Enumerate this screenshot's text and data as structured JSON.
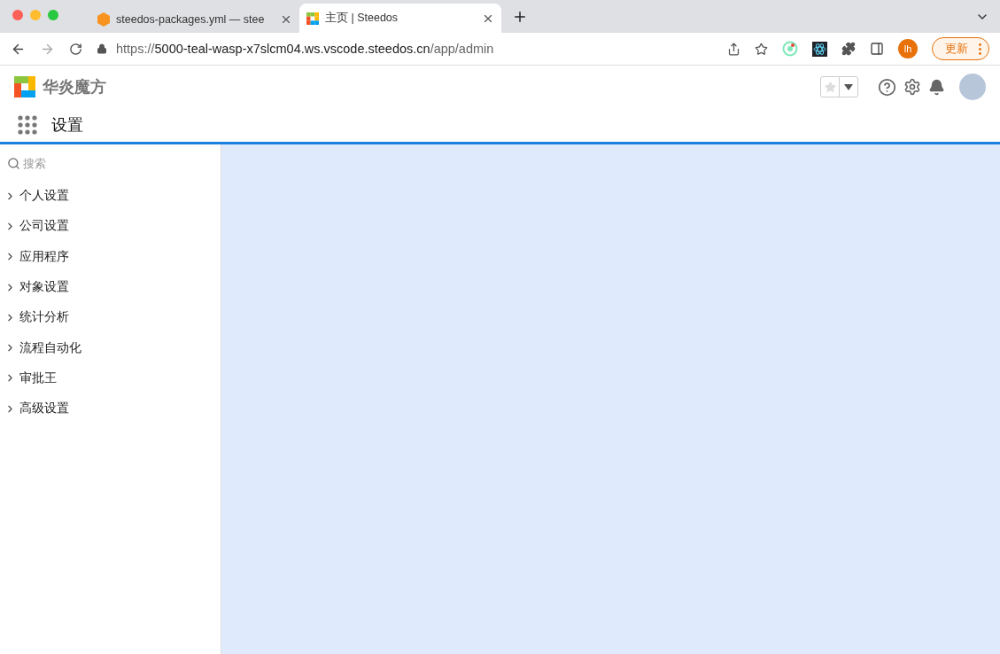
{
  "browser": {
    "tabs": [
      {
        "title": "steedos-packages.yml — stee",
        "selected": false,
        "kind": "editor"
      },
      {
        "title": "主页 | Steedos",
        "selected": true,
        "kind": "app"
      }
    ],
    "url": {
      "scheme": "https://",
      "host": "5000-teal-wasp-x7slcm04.ws.vscode.steedos.cn",
      "path": "/app/admin"
    },
    "profile": "lh",
    "update_button": "更新"
  },
  "app": {
    "logo_text": "华炎魔方",
    "app_name": "设置",
    "favorite": false
  },
  "sidebar": {
    "search": {
      "placeholder": "搜索"
    },
    "items": [
      {
        "label": "个人设置",
        "expanded": false
      },
      {
        "label": "公司设置",
        "expanded": false
      },
      {
        "label": "应用程序",
        "expanded": false
      },
      {
        "label": "对象设置",
        "expanded": false
      },
      {
        "label": "统计分析",
        "expanded": false
      },
      {
        "label": "流程自动化",
        "expanded": false
      },
      {
        "label": "审批王",
        "expanded": false
      },
      {
        "label": "高级设置",
        "expanded": false
      }
    ]
  }
}
